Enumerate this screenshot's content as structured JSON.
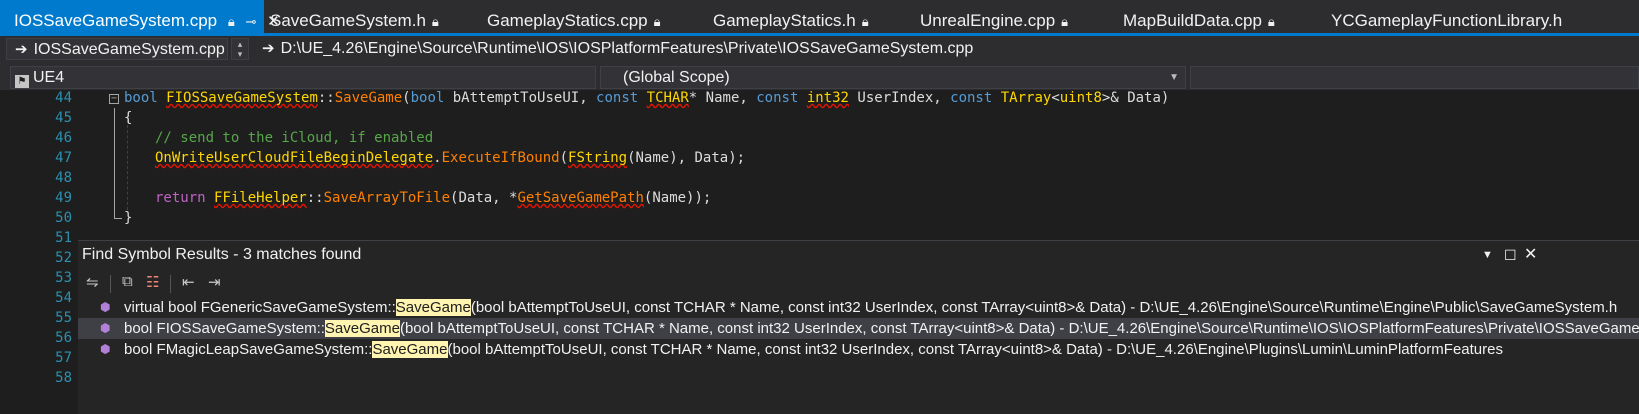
{
  "tabs": [
    {
      "label": "IOSSaveGameSystem.cpp",
      "active": true
    },
    {
      "label": "SaveGameSystem.h"
    },
    {
      "label": "GameplayStatics.cpp"
    },
    {
      "label": "GameplayStatics.h"
    },
    {
      "label": "UnrealEngine.cpp"
    },
    {
      "label": "MapBuildData.cpp"
    },
    {
      "label": "YCGameplayFunctionLibrary.h"
    }
  ],
  "nav": {
    "file": "IOSSaveGameSystem.cpp",
    "path": "D:\\UE_4.26\\Engine\\Source\\Runtime\\IOS\\IOSPlatformFeatures\\Private\\IOSSaveGameSystem.cpp"
  },
  "scope": {
    "project": "UE4",
    "scope": "(Global Scope)"
  },
  "line_numbers": [
    "44",
    "45",
    "46",
    "47",
    "48",
    "49",
    "50",
    "51",
    "52",
    "53",
    "54",
    "55",
    "56",
    "57",
    "58"
  ],
  "code": {
    "l44": {
      "kw1": "bool",
      "cls": "FIOSSaveGameSystem",
      "sep": "::",
      "fn": "SaveGame",
      "p1": "(",
      "kw2": "bool",
      "a1": " bAttemptToUseUI, ",
      "kw3": "const",
      "t1": "TCHAR",
      "a2": "* Name, ",
      "kw4": "const",
      "t2": "int32",
      "a3": " UserIndex, ",
      "kw5": "const",
      "t3": "TArray",
      "lt": "<",
      "t4": "uint8",
      "rest": ">& Data)"
    },
    "l45": "{",
    "l46": "// send to the iCloud, if enabled",
    "l47": {
      "obj": "OnWriteUserCloudFileBeginDelegate",
      "dot": ".",
      "fn": "ExecuteIfBound",
      "p": "(",
      "cls": "FString",
      "rest": "(Name), Data);"
    },
    "l49": {
      "kw": "return",
      "cls": "FFileHelper",
      "sep": "::",
      "fn": "SaveArrayToFile",
      "a": "(Data, *",
      "fn2": "GetSaveGamePath",
      "rest": "(Name));"
    },
    "l50": "}"
  },
  "panel": {
    "title": "Find Symbol Results - 3 matches found",
    "results": [
      {
        "pre": "virtual bool FGenericSaveGameSystem::",
        "match": "SaveGame",
        "post": "(bool bAttemptToUseUI, const TCHAR * Name, const int32 UserIndex, const TArray<uint8>& Data) - D:\\UE_4.26\\Engine\\Source\\Runtime\\Engine\\Public\\SaveGameSystem.h"
      },
      {
        "pre": "bool FIOSSaveGameSystem::",
        "match": "SaveGame",
        "post": "(bool bAttemptToUseUI, const TCHAR * Name, const int32 UserIndex, const TArray<uint8>& Data) - D:\\UE_4.26\\Engine\\Source\\Runtime\\IOS\\IOSPlatformFeatures\\Private\\IOSSaveGameSystem.cpp",
        "selected": true
      },
      {
        "pre": "bool FMagicLeapSaveGameSystem::",
        "match": "SaveGame",
        "post": "(bool bAttemptToUseUI, const TCHAR * Name, const int32 UserIndex, const TArray<uint8>& Data) - D:\\UE_4.26\\Engine\\Plugins\\Lumin\\LuminPlatformFeatures"
      }
    ]
  }
}
